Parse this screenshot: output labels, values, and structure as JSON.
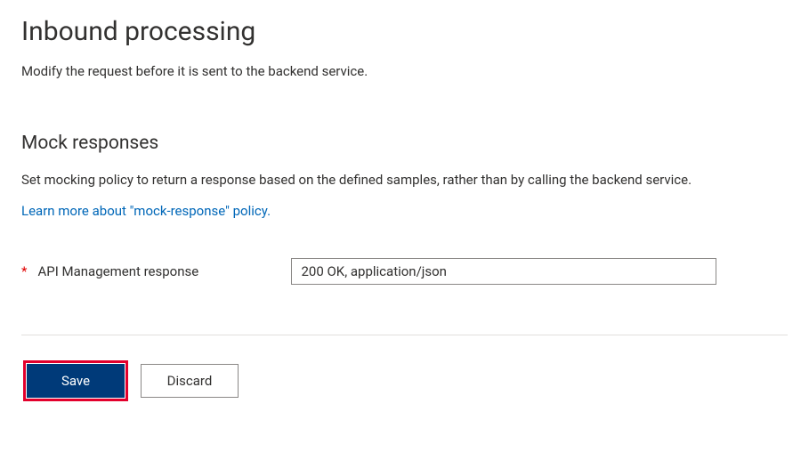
{
  "header": {
    "title": "Inbound processing",
    "subtitle": "Modify the request before it is sent to the backend service."
  },
  "mock": {
    "section_title": "Mock responses",
    "description": "Set mocking policy to return a response based on the defined samples, rather than by calling the backend service.",
    "learn_more": "Learn more about \"mock-response\" policy.",
    "field_label": "API Management response",
    "selected_value": "200 OK, application/json"
  },
  "footer": {
    "save": "Save",
    "discard": "Discard"
  }
}
